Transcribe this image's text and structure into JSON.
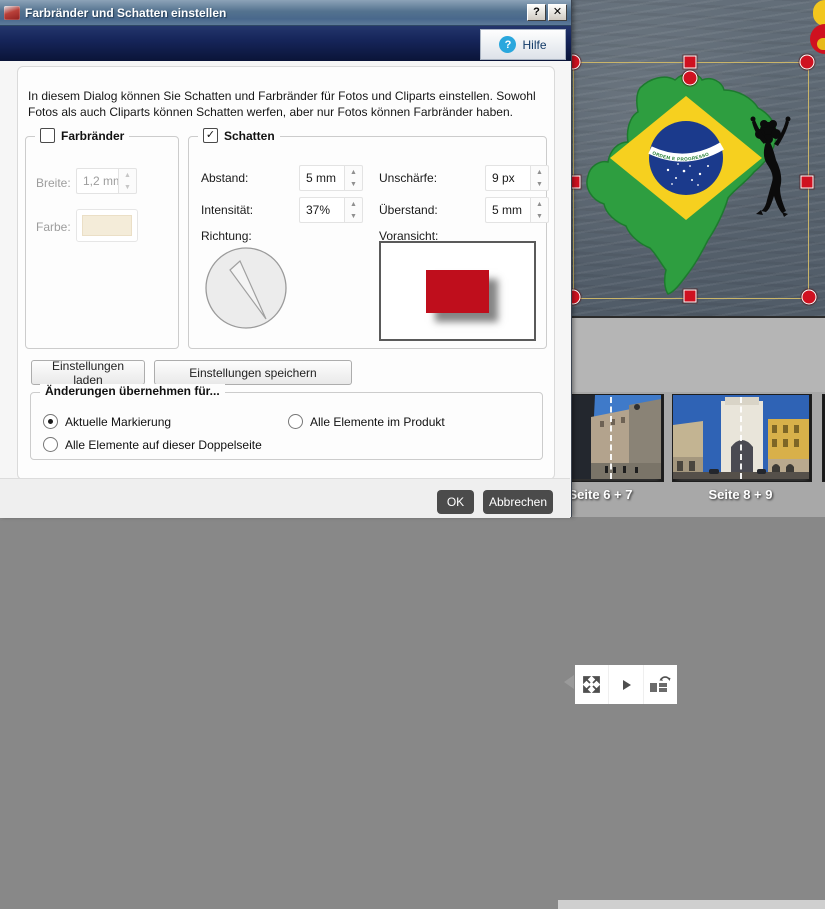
{
  "dialog": {
    "title": "Farbränder und Schatten einstellen",
    "titlebar": {
      "help_glyph": "?",
      "close_glyph": "✕"
    },
    "help_button_label": "Hilfe",
    "description": "In diesem Dialog können Sie Schatten und Farbränder für Fotos und Cliparts einstellen. Sowohl Fotos als auch Cliparts können Schatten werfen, aber nur Fotos können Farbränder haben.",
    "farbraender": {
      "label": "Farbränder",
      "checked": false,
      "breite_label": "Breite:",
      "breite_value": "1,2 mm",
      "farbe_label": "Farbe:",
      "farbe_swatch_color": "#f4ecd9"
    },
    "schatten": {
      "label": "Schatten",
      "checked": true,
      "check_glyph": "✓",
      "abstand_label": "Abstand:",
      "abstand_value": "5 mm",
      "unschaerfe_label": "Unschärfe:",
      "unschaerfe_value": "9 px",
      "intensitaet_label": "Intensität:",
      "intensitaet_value": "37%",
      "ueberstand_label": "Überstand:",
      "ueberstand_value": "5 mm",
      "richtung_label": "Richtung:",
      "voransicht_label": "Voransicht:",
      "preview_rect_color": "#bf0e1c"
    },
    "spin_up_glyph": "▲",
    "spin_down_glyph": "▼",
    "load_button": "Einstellungen laden",
    "save_button": "Einstellungen speichern",
    "apply_group": {
      "title": "Änderungen übernehmen für...",
      "options": [
        {
          "label": "Aktuelle Markierung",
          "selected": true
        },
        {
          "label": "Alle Elemente im Produkt",
          "selected": false
        },
        {
          "label": "Alle Elemente auf dieser Doppelseite",
          "selected": false
        }
      ]
    },
    "ok_button": "OK",
    "cancel_button": "Abbrechen"
  },
  "editor": {
    "canvas": {
      "flag_banner_text": "ORDEM E PROGRESSO",
      "selection_handle_color": "#cf1120",
      "selection_line_color": "#c9b469"
    },
    "toolbar": {
      "icons": [
        "prev-page-icon",
        "fullscreen-icon",
        "play-icon",
        "spread-layout-rotate-icon"
      ]
    },
    "thumbnails": [
      {
        "label": "Seite 6 + 7"
      },
      {
        "label": "Seite 8 + 9"
      }
    ]
  }
}
